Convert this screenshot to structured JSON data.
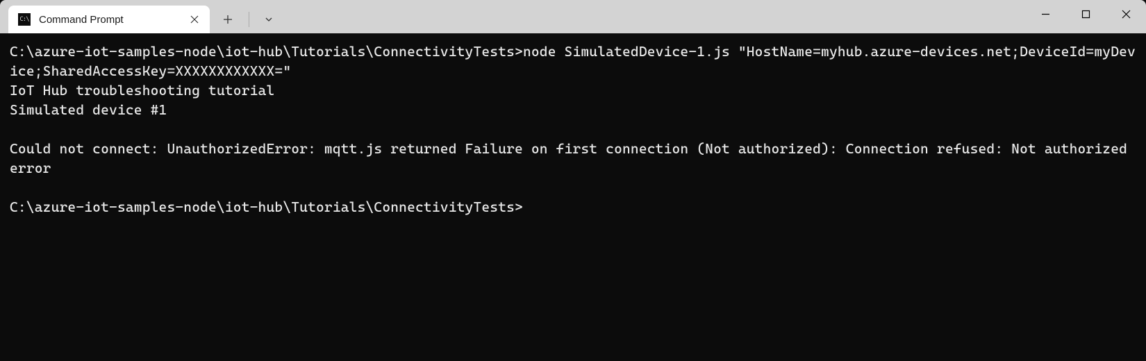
{
  "tab": {
    "title": "Command Prompt",
    "icon_name": "cmd-icon"
  },
  "terminal": {
    "lines": [
      "C:\\azure-iot-samples-node\\iot-hub\\Tutorials\\ConnectivityTests>node SimulatedDevice-1.js \"HostName=myhub.azure-devices.net;DeviceId=myDevice;SharedAccessKey=XXXXXXXXXXXX=\"",
      "IoT Hub troubleshooting tutorial",
      "Simulated device #1",
      "",
      "Could not connect: UnauthorizedError: mqtt.js returned Failure on first connection (Not authorized): Connection refused: Not authorized error",
      "",
      "C:\\azure-iot-samples-node\\iot-hub\\Tutorials\\ConnectivityTests>"
    ]
  }
}
